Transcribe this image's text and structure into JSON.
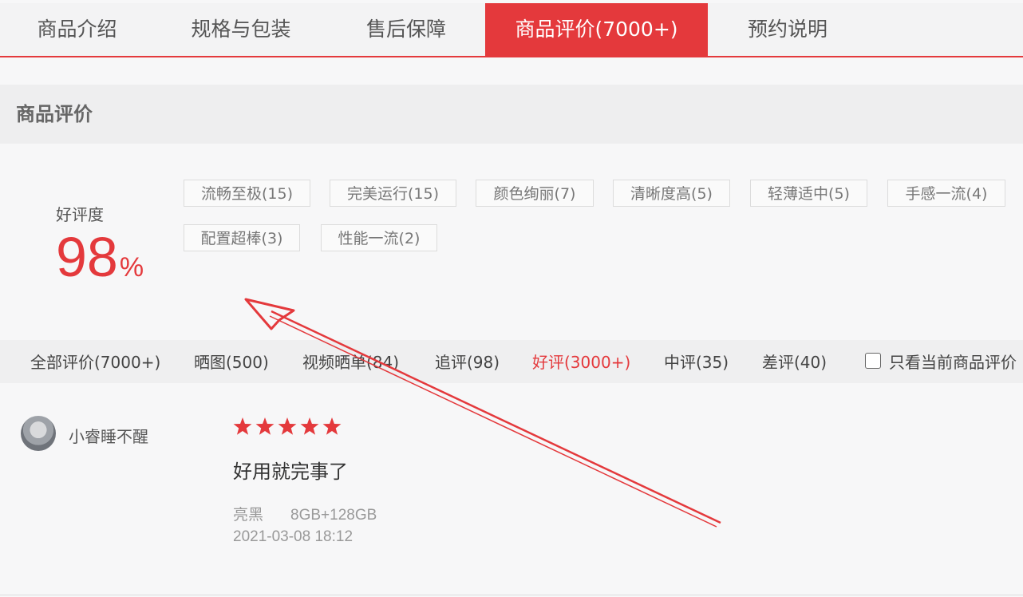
{
  "tabs": [
    {
      "label": "商品介绍"
    },
    {
      "label": "规格与包装"
    },
    {
      "label": "售后保障"
    },
    {
      "label": "商品评价(7000+)"
    },
    {
      "label": "预约说明"
    }
  ],
  "section": {
    "title": "商品评价"
  },
  "rating": {
    "label": "好评度",
    "value": "98",
    "unit": "%"
  },
  "tags": [
    "流畅至极(15)",
    "完美运行(15)",
    "颜色绚丽(7)",
    "清晰度高(5)",
    "轻薄适中(5)",
    "手感一流(4)",
    "配置超棒(3)",
    "性能一流(2)"
  ],
  "filters": [
    "全部评价(7000+)",
    "晒图(500)",
    "视频晒单(84)",
    "追评(98)",
    "好评(3000+)",
    "中评(35)",
    "差评(40)"
  ],
  "only_current_label": "只看当前商品评价",
  "review": {
    "username": "小睿睡不醒",
    "stars": 5,
    "text": "好用就完事了",
    "color": "亮黑",
    "config": "8GB+128GB",
    "time": "2021-03-08 18:12"
  },
  "colors": {
    "accent": "#e4393c"
  }
}
